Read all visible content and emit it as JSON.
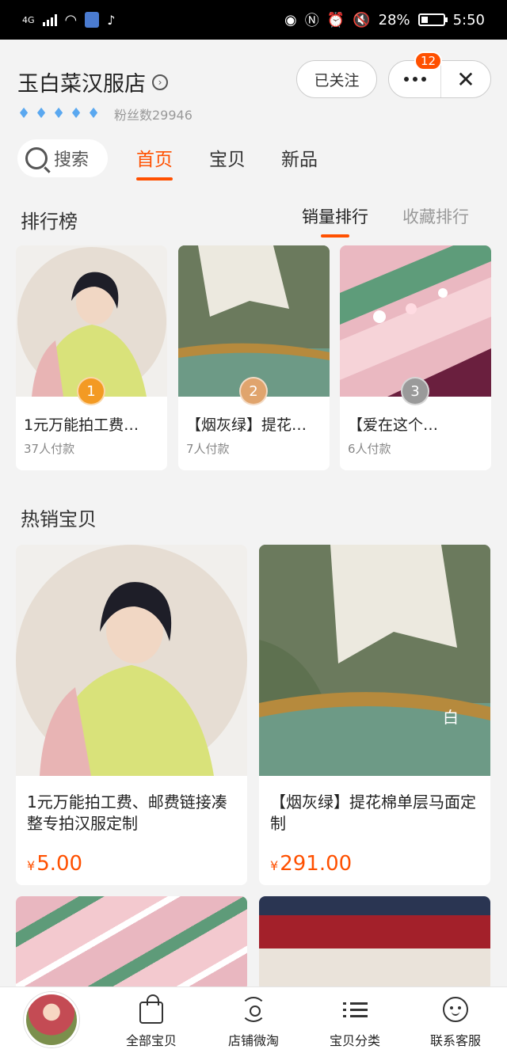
{
  "status_bar": {
    "network": "4G",
    "battery": "28%",
    "time": "5:50",
    "icons": [
      "signal-icon",
      "wifi-icon",
      "vpn-shield-icon",
      "tiktok-icon",
      "eye-icon",
      "nfc-icon",
      "alarm-icon",
      "mute-icon",
      "battery-icon"
    ]
  },
  "header": {
    "shop_name": "玉白菜汉服店",
    "fans": "粉丝数29946",
    "diamond_count": 5,
    "follow_label": "已关注",
    "more_badge": "12"
  },
  "nav": {
    "search_label": "搜索",
    "tabs": [
      "首页",
      "宝贝",
      "新品"
    ],
    "active_tab": "首页"
  },
  "ranking": {
    "title": "排行榜",
    "tabs": [
      "销量排行",
      "收藏排行"
    ],
    "active_tab": "销量排行",
    "items": [
      {
        "rank": "1",
        "name": "1元万能拍工费…",
        "sales": "37人付款"
      },
      {
        "rank": "2",
        "name": "【烟灰绿】提花…",
        "sales": "7人付款"
      },
      {
        "rank": "3",
        "name": "【爱在这个…",
        "sales": "6人付款"
      }
    ]
  },
  "hot": {
    "title": "热销宝贝",
    "items": [
      {
        "name": "1元万能拍工费、邮费链接凑整专拍汉服定制",
        "currency": "¥",
        "price": "5.00"
      },
      {
        "name": "【烟灰绿】提花棉单层马面定制",
        "currency": "¥",
        "price": "291.00"
      }
    ]
  },
  "bottom_bar": {
    "items": [
      "全部宝贝",
      "店铺微淘",
      "宝贝分类",
      "联系客服"
    ]
  },
  "colors": {
    "accent": "#ff5000",
    "background": "#f3f3f3"
  }
}
